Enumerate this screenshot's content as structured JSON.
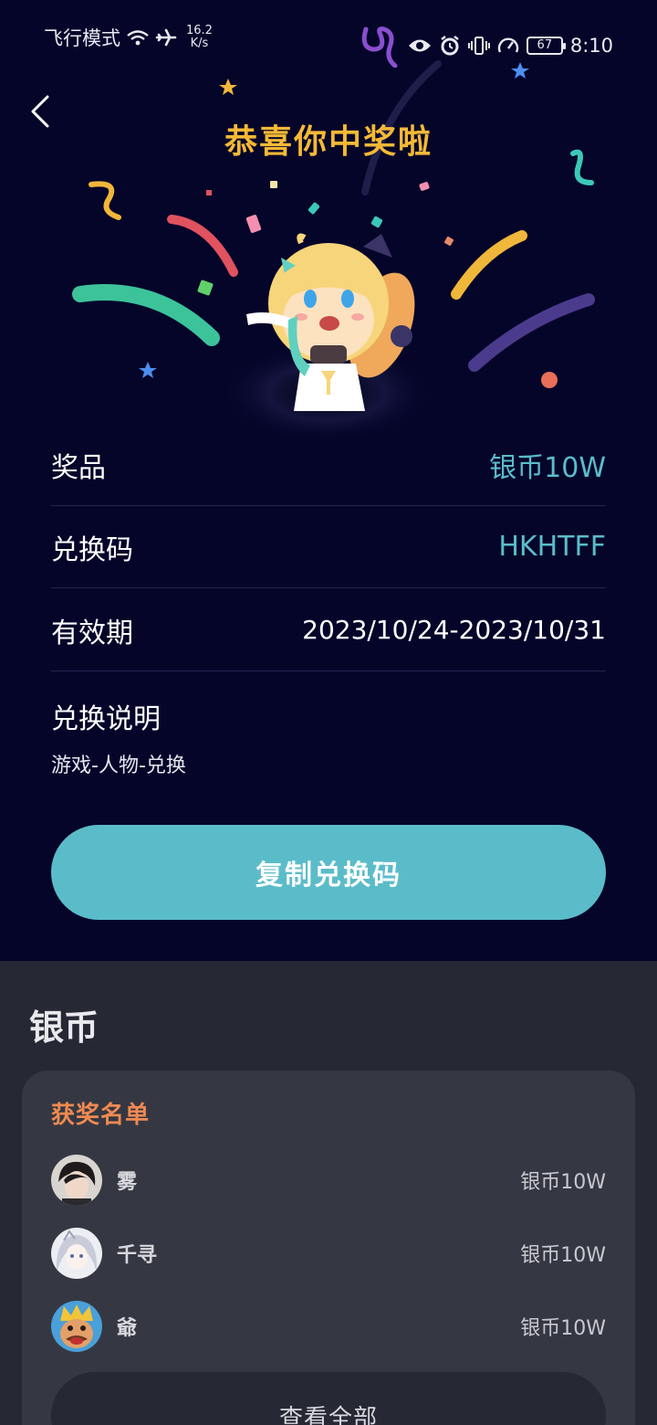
{
  "status_bar": {
    "airplane_mode_text": "飞行模式",
    "net_speed_value": "16.2",
    "net_speed_unit": "K/s",
    "battery": "67",
    "time": "8:10",
    "icons_left": [
      "wifi-icon",
      "airplane-icon"
    ],
    "icons_right": [
      "app-logo-icon",
      "eye-icon",
      "alarm-icon",
      "vibrate-icon",
      "speed-icon",
      "battery-icon"
    ]
  },
  "header": {
    "title": "恭喜你中奖啦",
    "back_icon": "chevron-left-icon"
  },
  "prize_info": {
    "prize_label": "奖品",
    "prize_value": "银币10W",
    "code_label": "兑换码",
    "code_value": "HKHTFF",
    "validity_label": "有效期",
    "validity_value": "2023/10/24-2023/10/31",
    "instructions_label": "兑换说明",
    "instructions_text": "游戏-人物-兑换"
  },
  "copy_button_label": "复制兑换码",
  "section": {
    "title": "银币",
    "list_title": "获奖名单",
    "winners": [
      {
        "name": "雾",
        "prize": "银币10W"
      },
      {
        "name": "千寻",
        "prize": "银币10W"
      },
      {
        "name": "爺",
        "prize": "银币10W"
      }
    ],
    "view_all_label": "查看全部"
  },
  "colors": {
    "background": "#05052a",
    "title_gold": "#f5b935",
    "accent_teal": "#5bbcc9",
    "list_title_orange": "#f08a52",
    "bottom_bg": "#262834",
    "card_bg": "#353842"
  }
}
